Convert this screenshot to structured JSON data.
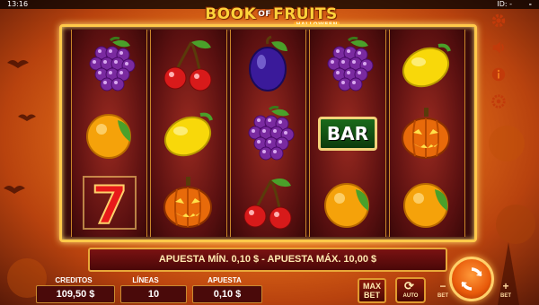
{
  "status_bar": {
    "time": "13:16",
    "id_label": "ID: -",
    "dash": "-"
  },
  "logo": {
    "word1": "BOOK",
    "word_of": "OF",
    "word2": "FRUITS",
    "sub": "HALLOWEEN"
  },
  "colors": {
    "frame_gold": "#ffc94a",
    "reel_red": "#5a1010",
    "accent_orange": "#e85a0a"
  },
  "side_icons": [
    "gear-icon",
    "sound-icon",
    "info-icon",
    "settings-icon"
  ],
  "reels": [
    [
      "grapes",
      "orange",
      "seven"
    ],
    [
      "cherries",
      "lemon",
      "pumpkin"
    ],
    [
      "plum",
      "grapes",
      "cherries"
    ],
    [
      "grapes",
      "bar",
      "orange"
    ],
    [
      "lemon",
      "pumpkin",
      "orange"
    ]
  ],
  "bar_label": "BAR",
  "seven_label": "7",
  "message": "APUESTA MÍN. 0,10 $ - APUESTA MÁX. 10,00 $",
  "credits": {
    "label": "CREDITOS",
    "value": "109,50 $"
  },
  "lines": {
    "label": "LÍNEAS",
    "value": "10"
  },
  "bet": {
    "label": "APUESTA",
    "value": "0,10 $"
  },
  "buttons": {
    "max_bet": "MAX BET",
    "auto": "AUTO",
    "bet_minus": "BET",
    "bet_plus": "BET",
    "minus_sym": "−",
    "plus_sym": "+"
  }
}
